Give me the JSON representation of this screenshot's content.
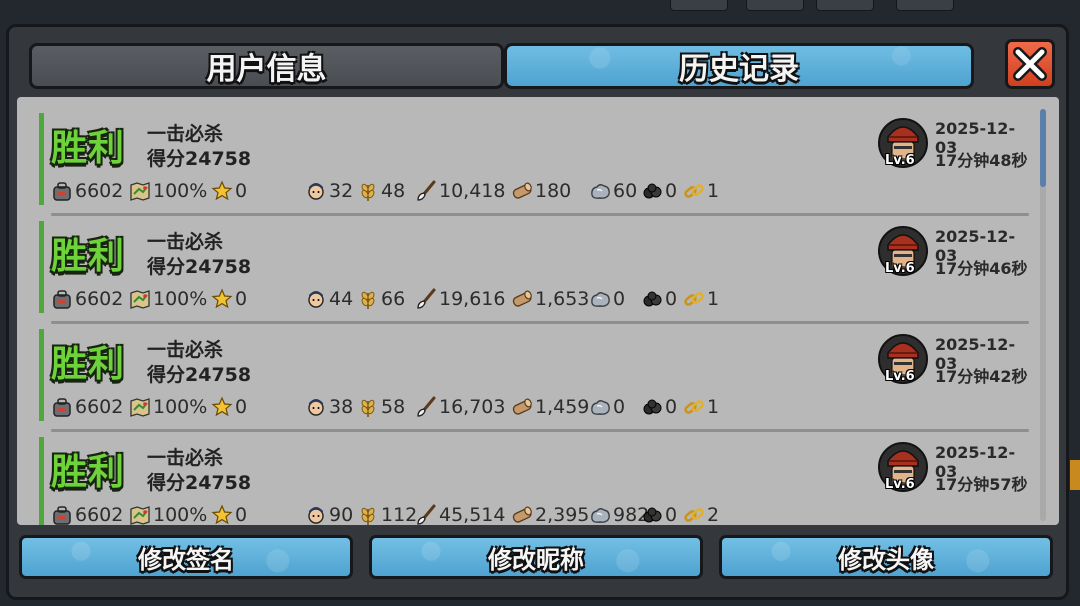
{
  "tabs": {
    "user_info": "用户信息",
    "history": "历史记录"
  },
  "close_icon": "close-x-icon",
  "buttons": {
    "edit_signature": "修改签名",
    "edit_nickname": "修改昵称",
    "edit_avatar": "修改头像"
  },
  "stat_icons": [
    "backpack-icon",
    "map-icon",
    "star-icon",
    "villager-icon",
    "wheat-icon",
    "brush-icon",
    "wood-log-icon",
    "stone-icon",
    "coal-icon",
    "chain-icon"
  ],
  "colors": {
    "win": "#6ed23a",
    "accent_blue": "#4fa3d1",
    "close_red": "#e0502e",
    "list_bg": "#b8b8b8"
  },
  "history": [
    {
      "result": "胜利",
      "mode": "一击必杀",
      "score": "得分24758",
      "level": "Lv.6",
      "date": "2025-12-03",
      "duration": "17分钟48秒",
      "stats": [
        "6602",
        "100%",
        "0",
        "32",
        "48",
        "10,418",
        "180",
        "60",
        "0",
        "1"
      ]
    },
    {
      "result": "胜利",
      "mode": "一击必杀",
      "score": "得分24758",
      "level": "Lv.6",
      "date": "2025-12-03",
      "duration": "17分钟46秒",
      "stats": [
        "6602",
        "100%",
        "0",
        "44",
        "66",
        "19,616",
        "1,653",
        "0",
        "0",
        "1"
      ]
    },
    {
      "result": "胜利",
      "mode": "一击必杀",
      "score": "得分24758",
      "level": "Lv.6",
      "date": "2025-12-03",
      "duration": "17分钟42秒",
      "stats": [
        "6602",
        "100%",
        "0",
        "38",
        "58",
        "16,703",
        "1,459",
        "0",
        "0",
        "1"
      ]
    },
    {
      "result": "胜利",
      "mode": "一击必杀",
      "score": "得分24758",
      "level": "Lv.6",
      "date": "2025-12-03",
      "duration": "17分钟57秒",
      "stats": [
        "6602",
        "100%",
        "0",
        "90",
        "112",
        "45,514",
        "2,395",
        "982",
        "0",
        "2"
      ]
    }
  ]
}
